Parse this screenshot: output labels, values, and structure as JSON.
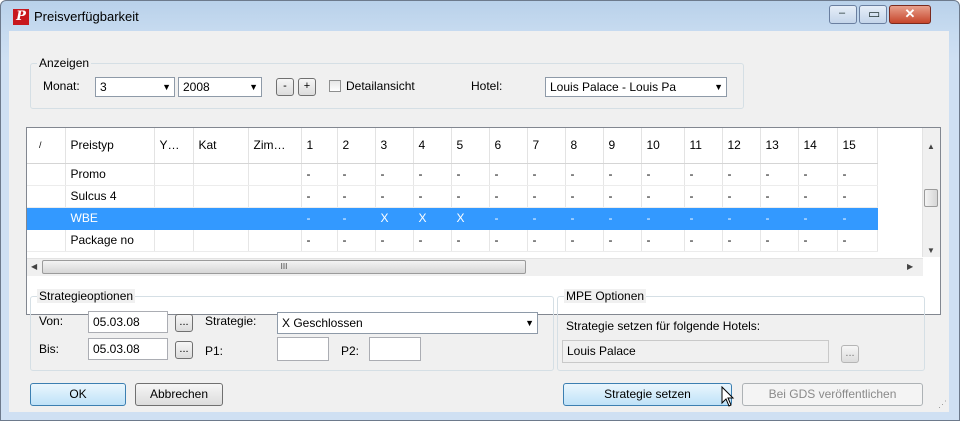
{
  "window": {
    "title": "Preisverfügbarkeit",
    "app_icon_glyph": "P",
    "minimize_glyph": "‒",
    "maximize_glyph": "▭",
    "close_glyph": "✕"
  },
  "anzeigen": {
    "label": "Anzeigen",
    "monat_label": "Monat:",
    "monat_value": "3",
    "jahr_value": "2008",
    "minus_label": "-",
    "plus_label": "+",
    "detail_label": "Detailansicht",
    "hotel_label": "Hotel:",
    "hotel_value": "Louis Palace - Louis Pa"
  },
  "grid": {
    "columns": [
      "/",
      "Preistyp",
      "Y…",
      "Kat",
      "Zim…",
      "1",
      "2",
      "3",
      "4",
      "5",
      "6",
      "7",
      "8",
      "9",
      "10",
      "11",
      "12",
      "13",
      "14",
      "15"
    ],
    "rows": [
      {
        "cells": [
          "",
          "Promo",
          "",
          "",
          "",
          "-",
          "-",
          "-",
          "-",
          "-",
          "-",
          "-",
          "-",
          "-",
          "-",
          "-",
          "-",
          "-",
          "-",
          "-"
        ],
        "selected": false
      },
      {
        "cells": [
          "",
          "Sulcus 4",
          "",
          "",
          "",
          "-",
          "-",
          "-",
          "-",
          "-",
          "-",
          "-",
          "-",
          "-",
          "-",
          "-",
          "-",
          "-",
          "-",
          "-"
        ],
        "selected": false
      },
      {
        "cells": [
          "",
          "WBE",
          "",
          "",
          "",
          "-",
          "-",
          "X",
          "X",
          "X",
          "-",
          "-",
          "-",
          "-",
          "-",
          "-",
          "-",
          "-",
          "-",
          "-"
        ],
        "selected": true
      },
      {
        "cells": [
          "",
          "Package no",
          "",
          "",
          "",
          "-",
          "-",
          "-",
          "-",
          "-",
          "-",
          "-",
          "-",
          "-",
          "-",
          "-",
          "-",
          "-",
          "-",
          "-"
        ],
        "selected": false
      }
    ],
    "h_thumb_grip": "III"
  },
  "strategie": {
    "label": "Strategieoptionen",
    "von_label": "Von:",
    "von_value": "05.03.08",
    "bis_label": "Bis:",
    "bis_value": "05.03.08",
    "browse_label": "...",
    "strategie_label": "Strategie:",
    "strategie_value": "X Geschlossen",
    "p1_label": "P1:",
    "p1_value": "",
    "p2_label": "P2:",
    "p2_value": ""
  },
  "mpe": {
    "label": "MPE Optionen",
    "hint": "Strategie setzen für folgende Hotels:",
    "hotels_value": "Louis Palace",
    "browse_label": "..."
  },
  "buttons": {
    "ok": "OK",
    "cancel": "Abbrechen",
    "set_strategy": "Strategie setzen",
    "publish_gds": "Bei GDS veröffentlichen"
  },
  "colors": {
    "selection": "#3399ff",
    "close_button": "#c6452b",
    "app_icon": "#c8181e"
  }
}
